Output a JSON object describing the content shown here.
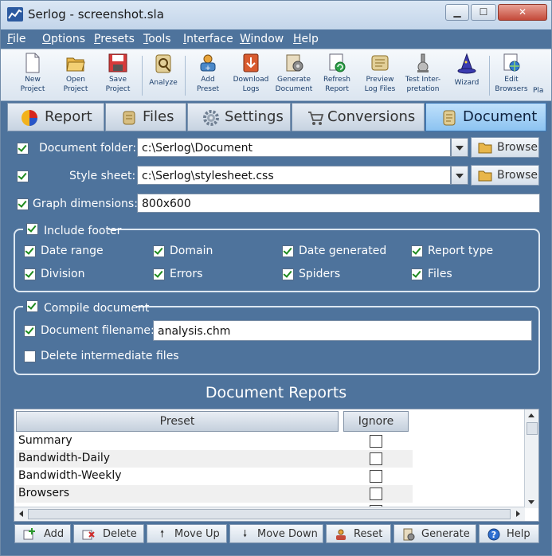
{
  "window": {
    "title": "Serlog - screenshot.sla"
  },
  "menu": [
    "File",
    "Options",
    "Presets",
    "Tools",
    "Interface",
    "Window",
    "Help"
  ],
  "toolbar": [
    {
      "l1": "New",
      "l2": "Project",
      "icon": "new-project-icon"
    },
    {
      "l1": "Open",
      "l2": "Project",
      "icon": "open-project-icon"
    },
    {
      "l1": "Save",
      "l2": "Project",
      "icon": "save-project-icon"
    },
    {
      "l1": "Analyze",
      "l2": "",
      "icon": "analyze-icon"
    },
    {
      "l1": "Add",
      "l2": "Preset",
      "icon": "add-preset-icon"
    },
    {
      "l1": "Download",
      "l2": "Logs",
      "icon": "download-logs-icon"
    },
    {
      "l1": "Generate",
      "l2": "Document",
      "icon": "generate-document-icon"
    },
    {
      "l1": "Refresh",
      "l2": "Report",
      "icon": "refresh-report-icon"
    },
    {
      "l1": "Preview",
      "l2": "Log Files",
      "icon": "preview-log-files-icon"
    },
    {
      "l1": "Test Inter-",
      "l2": "pretation",
      "icon": "test-interpretation-icon"
    },
    {
      "l1": "Wizard",
      "l2": "",
      "icon": "wizard-icon"
    },
    {
      "l1": "Edit",
      "l2": "Browsers",
      "icon": "edit-browsers-icon"
    },
    {
      "l1": "Pla",
      "l2": "",
      "icon": ""
    }
  ],
  "tabs": [
    "Report",
    "Files",
    "Settings",
    "Conversions",
    "Document"
  ],
  "active_tab": "Document",
  "form": {
    "document_folder_label": "Document folder:",
    "document_folder": "c:\\Serlog\\Document",
    "style_sheet_label": "Style sheet:",
    "style_sheet": "c:\\Serlog\\stylesheet.css",
    "browse": "Browse",
    "graph_dimensions_label": "Graph dimensions:",
    "graph_dimensions": "800x600"
  },
  "footer": {
    "title": "Include footer",
    "items": [
      "Date range",
      "Domain",
      "Date generated",
      "Report type",
      "Division",
      "Errors",
      "Spiders",
      "Files"
    ]
  },
  "compile": {
    "title": "Compile document",
    "filename_label": "Document filename:",
    "filename": "analysis.chm",
    "delete_label": "Delete intermediate files"
  },
  "reports": {
    "title": "Document Reports",
    "col_preset": "Preset",
    "col_ignore": "Ignore",
    "rows": [
      "Summary",
      "Bandwidth-Daily",
      "Bandwidth-Weekly",
      "Browsers"
    ]
  },
  "buttons": [
    "Add",
    "Delete",
    "Move Up",
    "Move Down",
    "Reset",
    "Generate",
    "Help"
  ]
}
